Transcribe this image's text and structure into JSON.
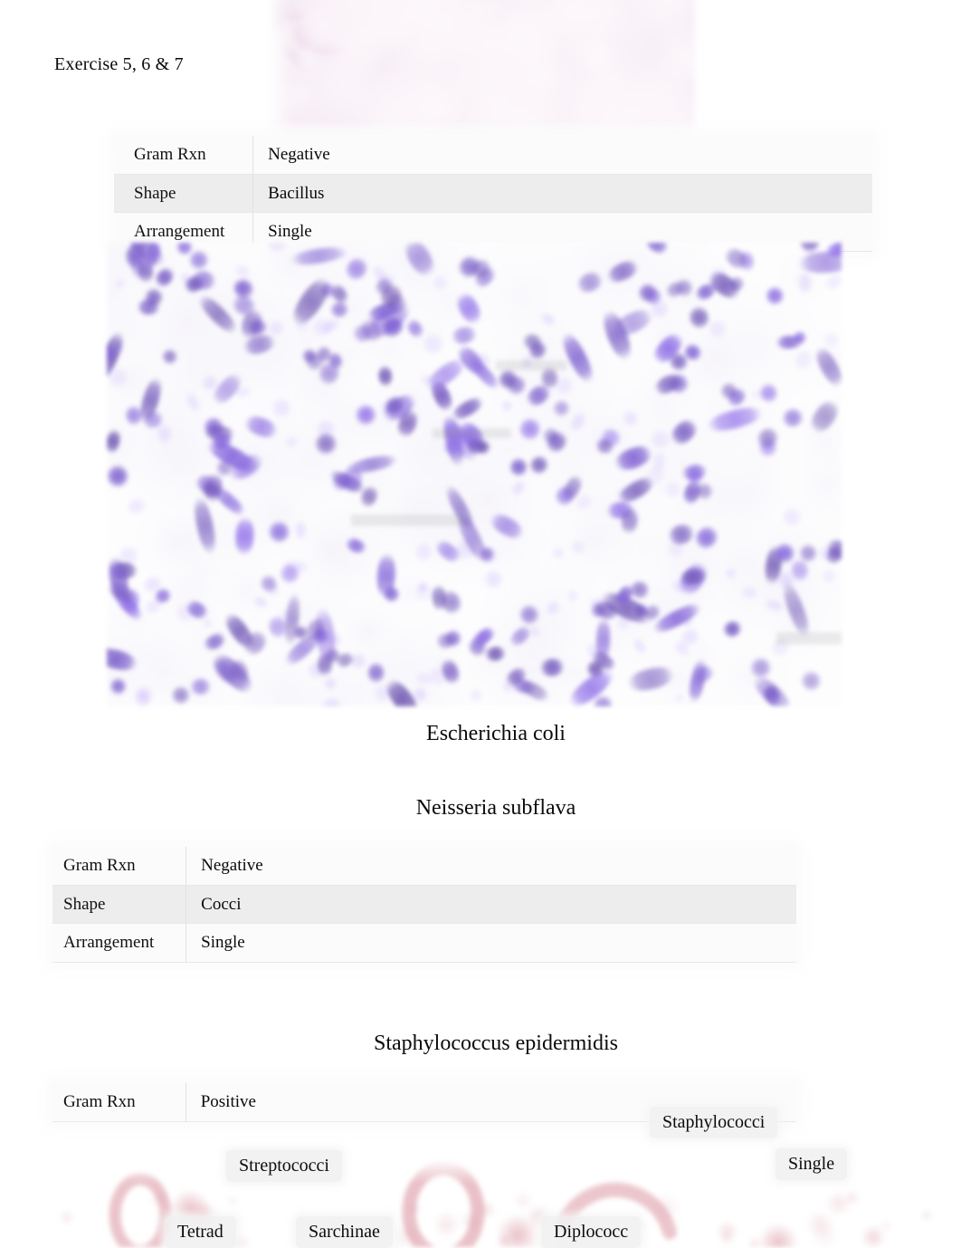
{
  "document": {
    "exercise_title": "Exercise 5, 6 & 7"
  },
  "organisms": [
    {
      "name": "Escherichia coli",
      "image": "gram-stain-micrograph-purple",
      "table": {
        "rows": [
          {
            "label": "Gram Rxn",
            "value": "Negative"
          },
          {
            "label": "Shape",
            "value": "Bacillus"
          },
          {
            "label": "Arrangement",
            "value": "Single"
          }
        ]
      }
    },
    {
      "name": "Neisseria subflava",
      "image": "gram-stain-micrograph-pink",
      "table": {
        "rows": [
          {
            "label": "Gram Rxn",
            "value": "Negative"
          },
          {
            "label": "Shape",
            "value": "Cocci"
          },
          {
            "label": "Arrangement",
            "value": "Single"
          }
        ]
      }
    },
    {
      "name": "Staphylococcus epidermidis",
      "table": {
        "rows": [
          {
            "label": "Gram Rxn",
            "value": "Positive"
          }
        ]
      }
    }
  ],
  "arrangement_chips": {
    "staphylococci": "Staphylococci",
    "single": "Single",
    "streptococci": "Streptococci",
    "tetrad": "Tetrad",
    "sarchinae": "Sarchinae",
    "diplococc": "Diplococc"
  },
  "colors": {
    "gram_positive_purple": "#7b5fc8",
    "gram_negative_pink": "#c98ac0",
    "cocci_illustration_pink": "#d98f9c",
    "table_stripe": "#ededed",
    "page_background": "#ffffff",
    "text": "#0a0a0a"
  }
}
